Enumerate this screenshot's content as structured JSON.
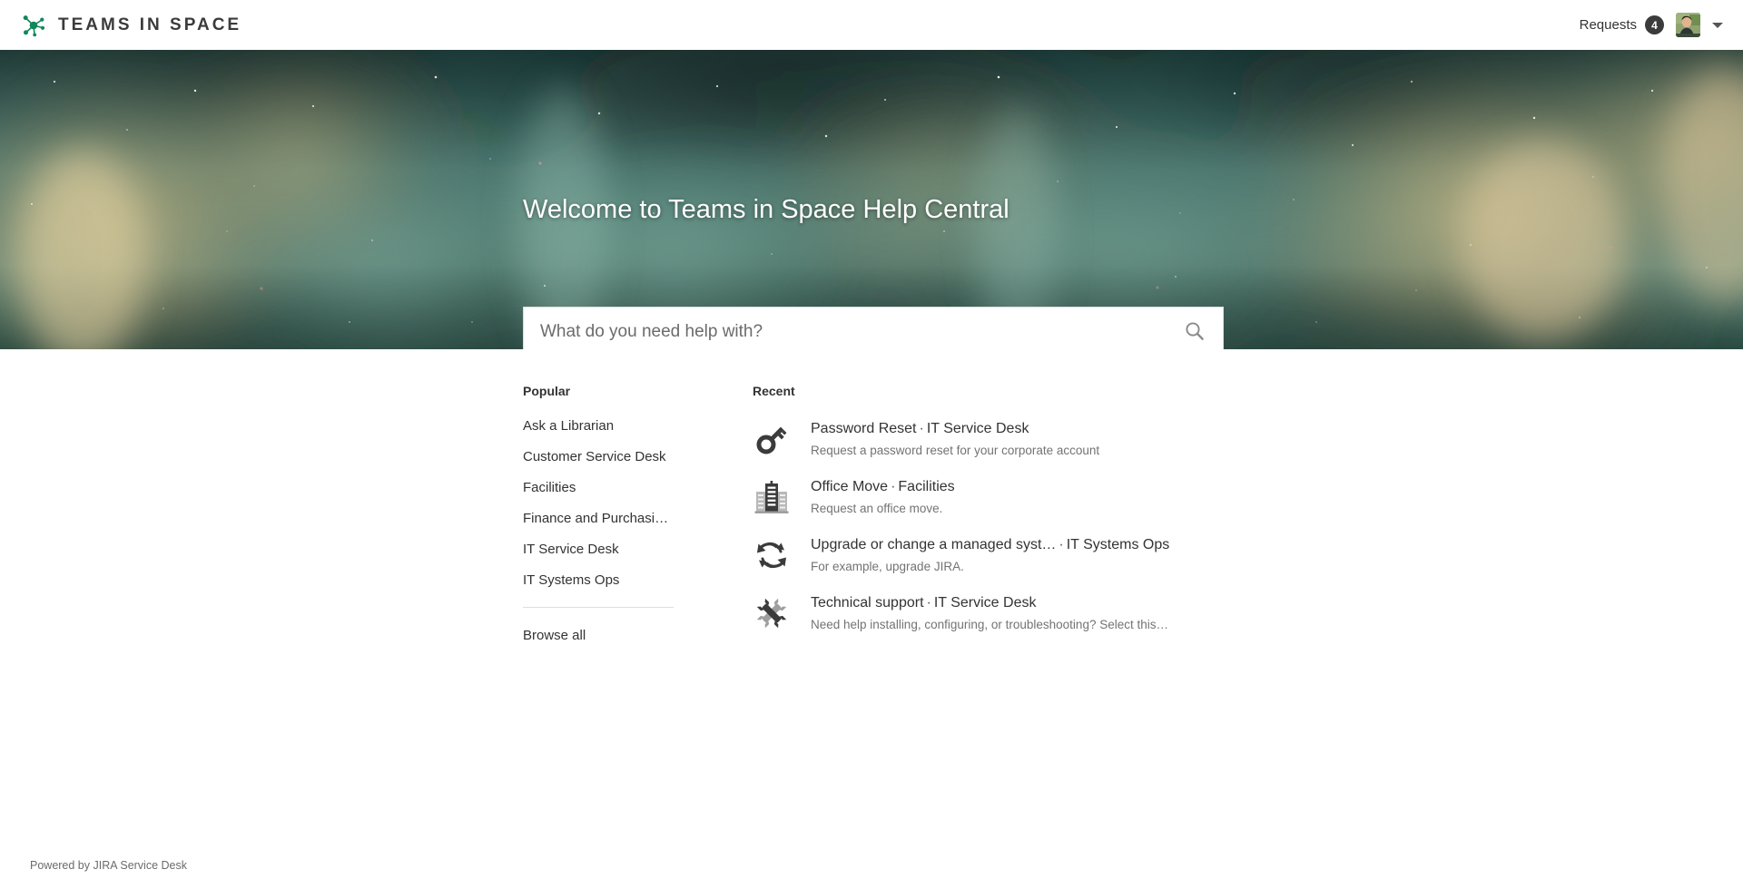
{
  "header": {
    "brand_name": "TEAMS IN SPACE",
    "logo_icon": "network-nodes-icon",
    "logo_color": "#11875a",
    "requests_label": "Requests",
    "requests_count": "4",
    "avatar_icon": "user-avatar",
    "caret_icon": "chevron-down-icon"
  },
  "hero": {
    "title": "Welcome to Teams in Space Help Central",
    "search_placeholder": "What do you need help with?",
    "search_value": "",
    "search_icon": "search-icon",
    "background": "nebula-space-photo",
    "background_colors": [
      "#2c4a46",
      "#6d9389",
      "#c9b98a",
      "#1d332f"
    ]
  },
  "popular": {
    "heading": "Popular",
    "items": [
      {
        "label": "Ask a Librarian"
      },
      {
        "label": "Customer Service Desk"
      },
      {
        "label": "Facilities"
      },
      {
        "label": "Finance and Purchasi…"
      },
      {
        "label": "IT Service Desk"
      },
      {
        "label": "IT Systems Ops"
      }
    ],
    "browse_all_label": "Browse all"
  },
  "recent": {
    "heading": "Recent",
    "items": [
      {
        "icon": "key-icon",
        "title": "Password Reset",
        "separator": "·",
        "service": "IT Service Desk",
        "description": "Request a password reset for your corporate account"
      },
      {
        "icon": "building-icon",
        "title": "Office Move",
        "separator": "·",
        "service": "Facilities",
        "description": "Request an office move."
      },
      {
        "icon": "sync-arrows-icon",
        "title": "Upgrade or change a managed syst…",
        "separator": "·",
        "service": "IT Systems Ops",
        "description": "For example, upgrade JIRA."
      },
      {
        "icon": "wrench-icon",
        "title": "Technical support",
        "separator": "·",
        "service": "IT Service Desk",
        "description": "Need help installing, configuring, or troubleshooting? Select this…"
      }
    ]
  },
  "footer": {
    "powered_by": "Powered by JIRA Service Desk"
  }
}
